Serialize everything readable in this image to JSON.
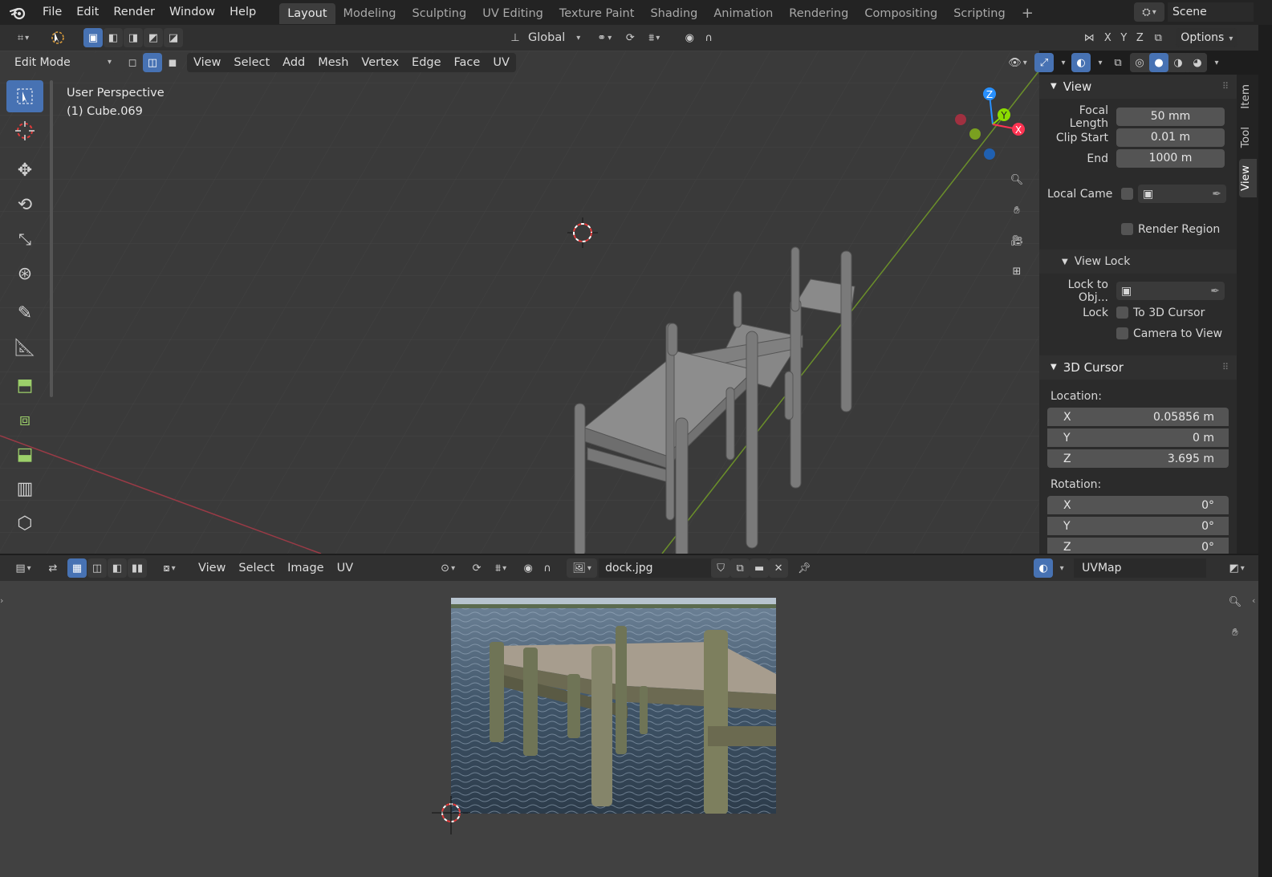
{
  "topbar": {
    "menus": [
      "File",
      "Edit",
      "Render",
      "Window",
      "Help"
    ],
    "workspaces": [
      "Layout",
      "Modeling",
      "Sculpting",
      "UV Editing",
      "Texture Paint",
      "Shading",
      "Animation",
      "Rendering",
      "Compositing",
      "Scripting"
    ],
    "active_workspace": "Layout",
    "scene": "Scene"
  },
  "tool_header": {
    "orientation": "Global",
    "axes": [
      "X",
      "Y",
      "Z"
    ],
    "options": "Options"
  },
  "viewport_header": {
    "mode": "Edit Mode",
    "menus": [
      "View",
      "Select",
      "Add",
      "Mesh",
      "Vertex",
      "Edge",
      "Face",
      "UV"
    ]
  },
  "viewport": {
    "perspective": "User Perspective",
    "object": "(1) Cube.069",
    "gizmo_axes": {
      "x": "X",
      "y": "Y",
      "z": "Z"
    }
  },
  "npanel": {
    "view_title": "View",
    "focal_length_label": "Focal Length",
    "focal_length": "50 mm",
    "clip_start_label": "Clip Start",
    "clip_start": "0.01 m",
    "clip_end_label": "End",
    "clip_end": "1000 m",
    "local_camera_label": "Local Came",
    "render_region": "Render Region",
    "view_lock_title": "View Lock",
    "lock_to_obj_label": "Lock to Obj...",
    "lock_label": "Lock",
    "to_3d_cursor": "To 3D Cursor",
    "camera_to_view": "Camera to View",
    "cursor_title": "3D Cursor",
    "location_label": "Location:",
    "loc_x": "0.05856 m",
    "loc_y": "0 m",
    "loc_z": "3.695 m",
    "rotation_label": "Rotation:",
    "rot_x": "0°",
    "rot_y": "0°",
    "rot_z": "0°",
    "axis_x": "X",
    "axis_y": "Y",
    "axis_z": "Z",
    "tabs": [
      "Item",
      "Tool",
      "View"
    ],
    "active_tab": "View"
  },
  "uv_header": {
    "menus": [
      "View",
      "Select",
      "Image",
      "UV"
    ],
    "image_name": "dock.jpg",
    "uvmap": "UVMap"
  },
  "colors": {
    "accent": "#4772b3",
    "x_axis": "#ff3352",
    "y_axis": "#8bdc00",
    "z_axis": "#2890ff"
  }
}
